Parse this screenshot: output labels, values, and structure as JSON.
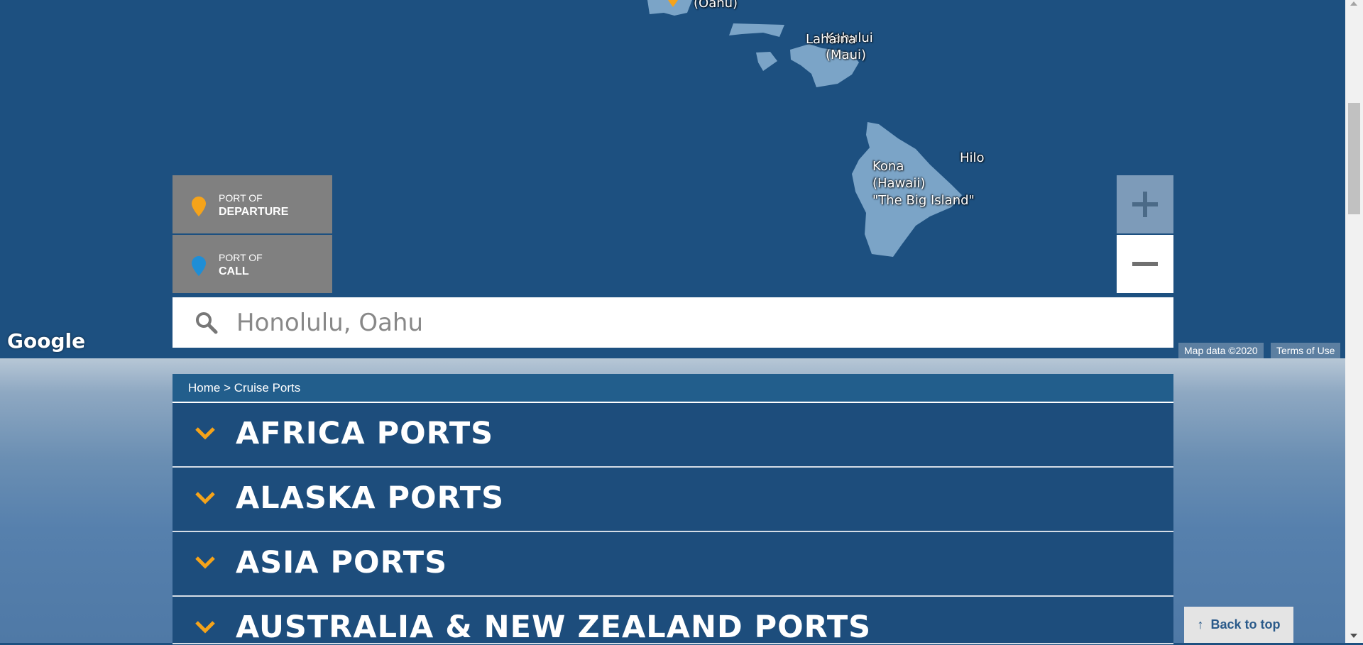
{
  "map": {
    "labels": {
      "oahu": "(Oahu)",
      "kahului": "Kahului\n(Maui)",
      "lahaina": "Lahaina",
      "hilo": "Hilo",
      "kona": "Kona\n(Hawaii)\n\"The Big Island\""
    },
    "google_logo": "Google",
    "map_data": "Map data ©2020",
    "terms": "Terms of Use",
    "water_color": "#1d5080",
    "land_color": "#7ba4c7"
  },
  "legend": {
    "departure": {
      "line1": "PORT OF",
      "line2": "DEPARTURE",
      "pin_color": "#f5a31a",
      "icon": "map-pin-icon"
    },
    "call": {
      "line1": "PORT OF",
      "line2": "CALL",
      "pin_color": "#1f8ed6",
      "icon": "map-pin-icon"
    }
  },
  "zoom": {
    "in_icon": "plus-icon",
    "out_icon": "minus-icon"
  },
  "search": {
    "value": "Honolulu, Oahu",
    "icon": "search-icon"
  },
  "breadcrumb": {
    "text": "Home > Cruise Ports"
  },
  "accordion": [
    {
      "label": "AFRICA PORTS"
    },
    {
      "label": "ALASKA PORTS"
    },
    {
      "label": "ASIA PORTS"
    },
    {
      "label": "AUSTRALIA & NEW ZEALAND PORTS"
    }
  ],
  "accent_color": "#f5a31a",
  "back_to_top": {
    "label": "Back to top"
  }
}
